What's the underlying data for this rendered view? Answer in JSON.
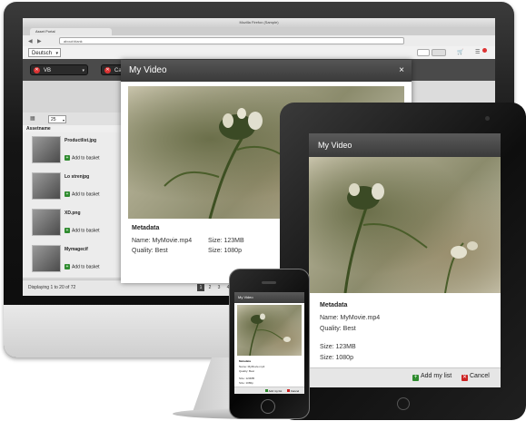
{
  "desktop": {
    "window_title": "Mozilla Firefox (Sample)",
    "tab_label": "Asset Portal",
    "url": "about:blank",
    "language": "Deutsch",
    "filters": [
      {
        "label": "VB"
      },
      {
        "label": "Cat"
      }
    ],
    "per_page": "25",
    "list_header": "Assetname",
    "assets": [
      {
        "name": "Productlist.jpg",
        "action": "Add to basket"
      },
      {
        "name": "Lo strenjpg",
        "action": "Add to basket"
      },
      {
        "name": "XD.png",
        "action": "Add to basket"
      },
      {
        "name": "Mymagecif",
        "action": "Add to basket"
      }
    ],
    "footer_status": "Displaying 1 to 20 of 72",
    "pages": [
      "1",
      "2",
      "3",
      "4"
    ],
    "modal": {
      "title": "My Video",
      "close": "×",
      "metadata_title": "Metadata",
      "name": "Name: MyMovie.mp4",
      "quality": "Quality: Best",
      "size_mb": "Size: 123MB",
      "size_px": "Size: 1080p"
    }
  },
  "tablet": {
    "title": "My Video",
    "metadata_title": "Metadata",
    "name": "Name: MyMovie.mp4",
    "quality": "Quality: Best",
    "size_mb": "Size: 123MB",
    "size_px": "Size: 1080p",
    "add_label": "Add my list",
    "cancel_label": "Cancel",
    "accent_green": "#2e8b2e",
    "accent_red": "#cc2222"
  },
  "phone": {
    "title": "My Video",
    "metadata_title": "Metadata",
    "name": "Name: MyMovie.mp4",
    "quality": "Quality: Best",
    "size_mb": "Size: 123MB",
    "size_px": "Size: 1080p",
    "add_label": "Add my list",
    "cancel_label": "Cancel"
  },
  "icons": [
    "close-icon",
    "add-icon",
    "cancel-icon",
    "chevron-down-icon",
    "cart-icon",
    "grid-icon"
  ]
}
